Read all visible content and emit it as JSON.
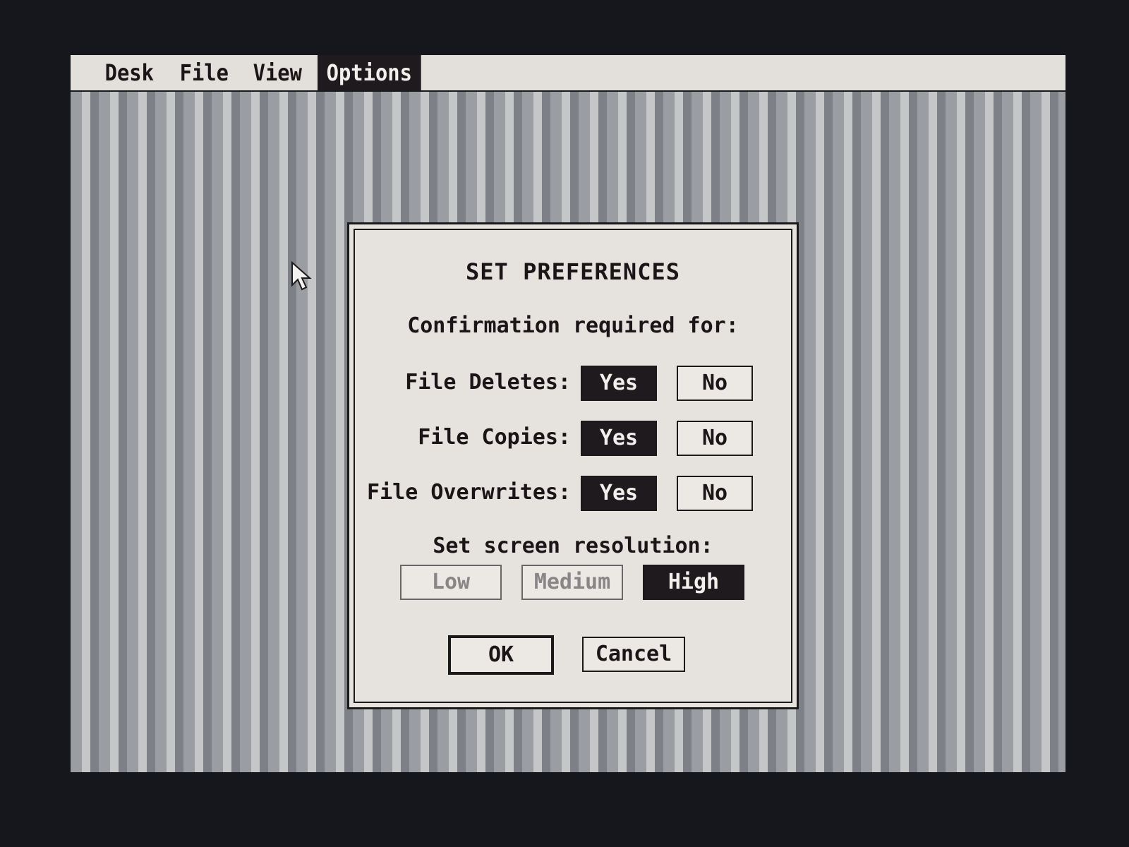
{
  "menubar": {
    "items": [
      {
        "label": "Desk"
      },
      {
        "label": "File"
      },
      {
        "label": "View"
      },
      {
        "label": "Options",
        "active": true
      }
    ]
  },
  "dialog": {
    "title": "SET PREFERENCES",
    "confirmation_heading": "Confirmation required for:",
    "rows": [
      {
        "label": "File Deletes:",
        "yes": "Yes",
        "no": "No",
        "selected": "Yes"
      },
      {
        "label": "File Copies:",
        "yes": "Yes",
        "no": "No",
        "selected": "Yes"
      },
      {
        "label": "File Overwrites:",
        "yes": "Yes",
        "no": "No",
        "selected": "Yes"
      }
    ],
    "resolution_heading": "Set screen resolution:",
    "resolutions": [
      {
        "label": "Low",
        "state": "disabled"
      },
      {
        "label": "Medium",
        "state": "disabled"
      },
      {
        "label": "High",
        "state": "selected"
      }
    ],
    "ok_label": "OK",
    "cancel_label": "Cancel"
  },
  "colors": {
    "desktop_stripe_light": "#c4c6c8",
    "desktop_stripe_dark": "#7d8086",
    "dialog_bg": "#e6e2de",
    "selected_bg": "#1e1a1d",
    "text": "#1b1518"
  },
  "icons": {
    "pointer": "mouse-pointer-icon"
  }
}
